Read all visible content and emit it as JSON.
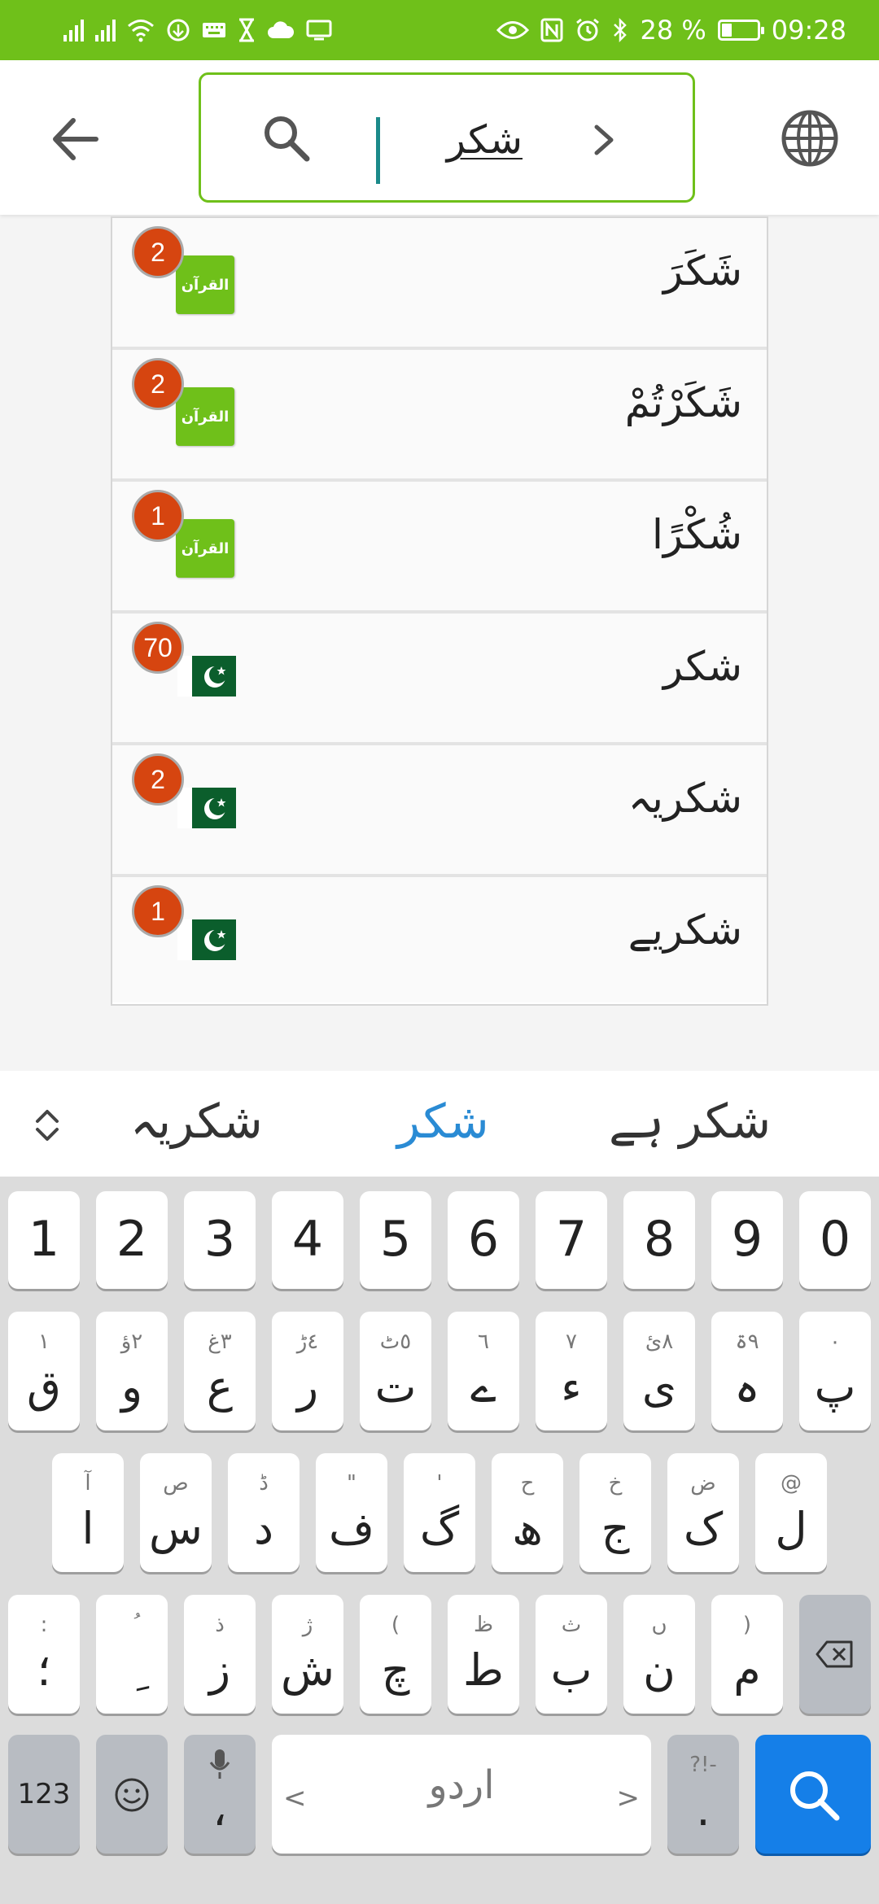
{
  "status_bar": {
    "battery_text": "28 %",
    "battery_level": 0.28,
    "time": "09:28",
    "icons": [
      "signal-icon",
      "signal-icon",
      "wifi-icon",
      "data-saver-icon",
      "keyboard-icon",
      "hourglass-icon",
      "cloud-icon",
      "cast-icon",
      "eye-icon",
      "nfc-icon",
      "alarm-icon",
      "bluetooth-icon",
      "battery-icon"
    ]
  },
  "header": {
    "search_query": "شکر",
    "icons": [
      "back-arrow-icon",
      "search-icon",
      "chevron-right-icon",
      "globe-icon"
    ]
  },
  "results": [
    {
      "word": "شَکَرَ",
      "count": "2",
      "source": "quran",
      "source_label": "القرآن"
    },
    {
      "word": "شَکَرْتُمْ",
      "count": "2",
      "source": "quran",
      "source_label": "القرآن"
    },
    {
      "word": "شُكْرًا",
      "count": "1",
      "source": "quran",
      "source_label": "القرآن"
    },
    {
      "word": "شکر",
      "count": "70",
      "source": "urdu"
    },
    {
      "word": "شکریہ",
      "count": "2",
      "source": "urdu"
    },
    {
      "word": "شکریے",
      "count": "1",
      "source": "urdu"
    }
  ],
  "suggestions": {
    "items": [
      "شکریہ",
      "شکر",
      "شکر ہے"
    ],
    "active_index": 1
  },
  "keyboard": {
    "numbers": [
      "1",
      "2",
      "3",
      "4",
      "5",
      "6",
      "7",
      "8",
      "9",
      "0"
    ],
    "row1": [
      {
        "hint": "١",
        "main": "ق"
      },
      {
        "hint": "٢ؤ",
        "main": "و"
      },
      {
        "hint": "٣غ",
        "main": "ع"
      },
      {
        "hint": "٤ڑ",
        "main": "ر"
      },
      {
        "hint": "٥ٹ",
        "main": "ت"
      },
      {
        "hint": "٦",
        "main": "ے"
      },
      {
        "hint": "٧",
        "main": "ء"
      },
      {
        "hint": "٨ئ",
        "main": "ی"
      },
      {
        "hint": "٩ۃ",
        "main": "ہ"
      },
      {
        "hint": "٠",
        "main": "پ"
      }
    ],
    "row2": [
      {
        "hint": "آ",
        "main": "ا"
      },
      {
        "hint": "ص",
        "main": "س"
      },
      {
        "hint": "ڈ",
        "main": "د"
      },
      {
        "hint": "\"",
        "main": "ف"
      },
      {
        "hint": "'",
        "main": "گ"
      },
      {
        "hint": "ح",
        "main": "ھ"
      },
      {
        "hint": "خ",
        "main": "ج"
      },
      {
        "hint": "ض",
        "main": "ک"
      },
      {
        "hint": "@",
        "main": "ل"
      }
    ],
    "row3": [
      {
        "hint": ":",
        "main": "؛"
      },
      {
        "hint": "ُ",
        "main": "ِ"
      },
      {
        "hint": "ذ",
        "main": "ز"
      },
      {
        "hint": "ژ",
        "main": "ش"
      },
      {
        "hint": "(",
        "main": "چ"
      },
      {
        "hint": "ظ",
        "main": "ط"
      },
      {
        "hint": "ث",
        "main": "ب"
      },
      {
        "hint": "ں",
        "main": "ن"
      },
      {
        "hint": ")",
        "main": "م"
      }
    ],
    "mode_label": "123",
    "comma_label": "،",
    "space_label": "اردو",
    "period_hint": "?!-",
    "period_main": ".",
    "space_left": "<",
    "space_right": ">"
  },
  "colors": {
    "brand_green": "#6fc01a",
    "badge_orange": "#d64510",
    "suggestion_active": "#2a8bd4",
    "search_key": "#157fe8",
    "flag_green": "#0b5e2c"
  }
}
